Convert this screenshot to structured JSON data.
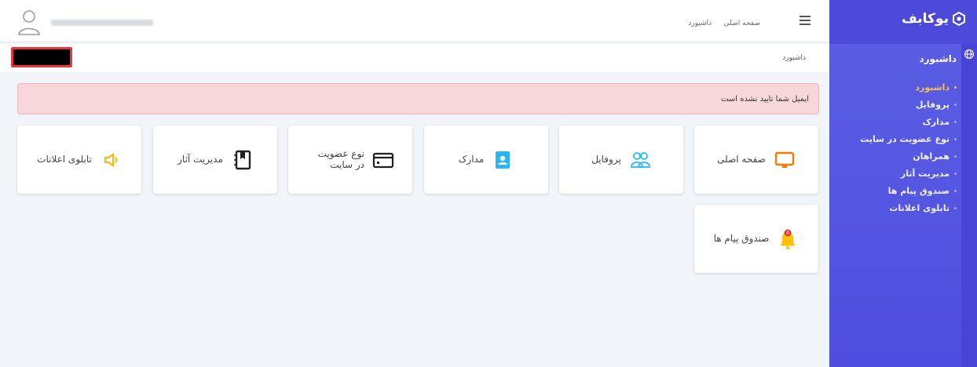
{
  "brand": {
    "name": "یوکابف",
    "accent": "#4f4ee0"
  },
  "topbar": {
    "links": [
      "صفحه اصلی",
      "داشبورد"
    ],
    "menu_icon": "hamburger-icon",
    "user_icon": "user-avatar-icon"
  },
  "breadcrumb": {
    "current": "داشبورد"
  },
  "alert": {
    "message": "ایمیل شما تایید نشده است"
  },
  "sidebar": {
    "title": "داشبورد",
    "items": [
      {
        "label": "داشبورد",
        "active": true
      },
      {
        "label": "پروفایل"
      },
      {
        "label": "مدارک"
      },
      {
        "label": "نوع عضویت در سایت"
      },
      {
        "label": "همراهان"
      },
      {
        "label": "مدیریت آثار"
      },
      {
        "label": "صندوق پیام ها"
      },
      {
        "label": "تابلوی اعلانات"
      }
    ]
  },
  "cards": [
    {
      "label": "صفحه اصلی",
      "icon": "monitor-icon",
      "color": "#f57c00"
    },
    {
      "label": "پروفایل",
      "icon": "users-icon",
      "color": "#29b6f6"
    },
    {
      "label": "مدارک",
      "icon": "document-icon",
      "color": "#29b6f6"
    },
    {
      "label": "نوع عضویت در سایت",
      "icon": "card-icon",
      "color": "#212121"
    },
    {
      "label": "مدیریت آثار",
      "icon": "notebook-icon",
      "color": "#212121"
    },
    {
      "label": "تابلوی اعلانات",
      "icon": "megaphone-icon",
      "color": "#ffb300"
    },
    {
      "label": "صندوق پیام ها",
      "icon": "bell-icon",
      "color": "#ffc107",
      "badge": "0"
    }
  ]
}
